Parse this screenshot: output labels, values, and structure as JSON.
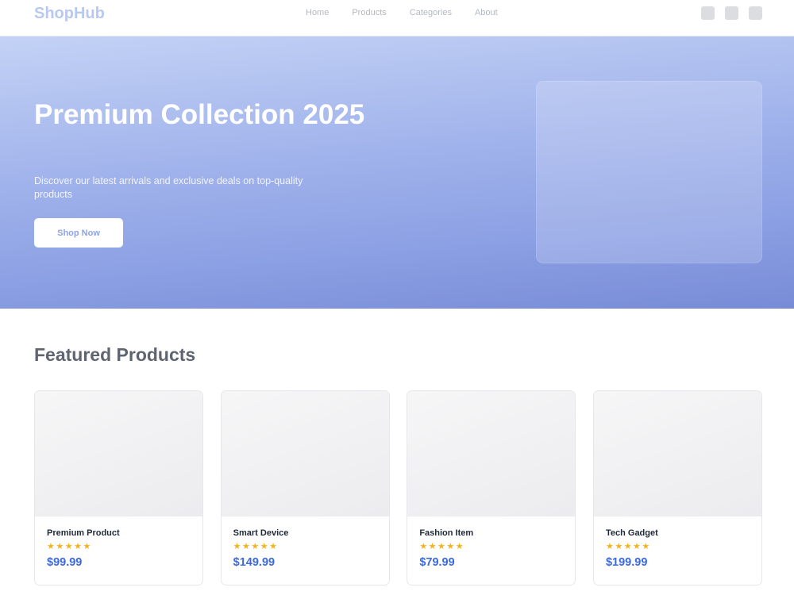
{
  "header": {
    "logo": "ShopHub",
    "nav": [
      "Home",
      "Products",
      "Categories",
      "About"
    ],
    "icons": [
      "search-icon",
      "user-icon",
      "cart-icon"
    ]
  },
  "hero": {
    "title": "Premium Collection 2025",
    "subtitle": "Discover our latest arrivals and exclusive deals on top-quality products",
    "cta_label": "Shop Now"
  },
  "featured": {
    "title": "Featured Products",
    "products": [
      {
        "name": "Premium Product",
        "stars": "★★★★★",
        "price": "$99.99"
      },
      {
        "name": "Smart Device",
        "stars": "★★★★★",
        "price": "$149.99"
      },
      {
        "name": "Fashion Item",
        "stars": "★★★★★",
        "price": "$79.99"
      },
      {
        "name": "Tech Gadget",
        "stars": "★★★★★",
        "price": "$199.99"
      }
    ]
  },
  "colors": {
    "accent": "#3b69e0",
    "star": "#f5b21b",
    "hero_start": "#c3d2f5",
    "hero_end": "#788bd6"
  }
}
